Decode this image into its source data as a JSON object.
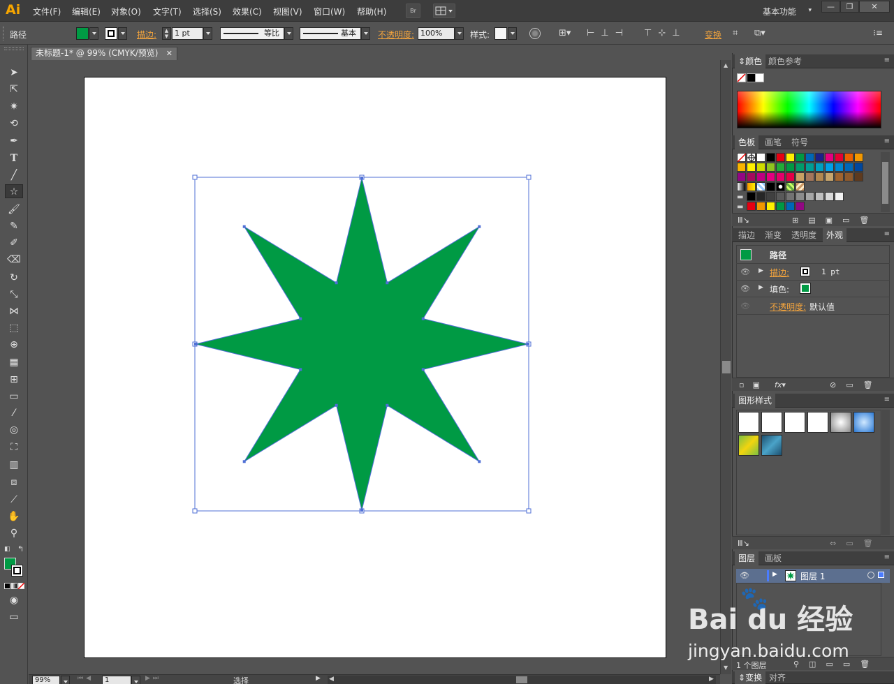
{
  "app": {
    "logo": "Ai",
    "menus": [
      "文件(F)",
      "编辑(E)",
      "对象(O)",
      "文字(T)",
      "选择(S)",
      "效果(C)",
      "视图(V)",
      "窗口(W)",
      "帮助(H)"
    ],
    "bridge_label": "Br",
    "workspace": "基本功能",
    "window_buttons": [
      "—",
      "❐",
      "✕"
    ]
  },
  "control": {
    "selection_type": "路径",
    "fill_color": "#009a44",
    "stroke_label": "描边:",
    "stroke_weight": "1 pt",
    "profile": "等比",
    "brush": "基本",
    "opacity_label": "不透明度:",
    "opacity": "100%",
    "style_label": "样式:",
    "transform_label": "变换"
  },
  "document": {
    "tab_title": "未标题-1* @ 99% (CMYK/预览)",
    "close": "✕",
    "star_color": "#009a44",
    "selection_color": "#4f6fd6"
  },
  "statusbar": {
    "zoom": "99%",
    "page": "1",
    "status": "选择"
  },
  "panels": {
    "color": {
      "tabs": [
        "颜色",
        "颜色参考"
      ]
    },
    "swatches": {
      "tabs": [
        "色板",
        "画笔",
        "符号"
      ]
    },
    "appearance": {
      "tabs": [
        "描边",
        "渐变",
        "透明度",
        "外观"
      ],
      "title": "路径",
      "stroke_label": "描边:",
      "stroke_value": "1 pt",
      "fill_label": "填色:",
      "opacity_label": "不透明度:",
      "opacity_value": "默认值"
    },
    "graphic_styles": {
      "tabs": [
        "图形样式"
      ]
    },
    "layers": {
      "tabs": [
        "图层",
        "画板"
      ],
      "layer_name": "图层 1",
      "count": "1 个图层"
    },
    "bottom_tabs": [
      "变换",
      "对齐"
    ]
  },
  "watermark": {
    "brand": "Bai du 经验",
    "url": "jingyan.baidu.com"
  },
  "swatch_colors": [
    [
      "none",
      "reg",
      "#ffffff",
      "#000000",
      "#e60012",
      "#fff100",
      "#009944",
      "#0068b7",
      "#1d2088",
      "#e4007f",
      "#e60033",
      "#eb6100",
      "#f39800"
    ],
    [
      "#f8b500",
      "#fff100",
      "#cfdb00",
      "#8fc31f",
      "#22ac38",
      "#009944",
      "#009b6b",
      "#009e96",
      "#00a0c1",
      "#00a0e9",
      "#0086d1",
      "#0068b7",
      "#00479d"
    ],
    [
      "#920783",
      "#a40b5d",
      "#be0081",
      "#e4007f",
      "#e5006a",
      "#e50046",
      "#c9a063",
      "#a4765b",
      "#b28850",
      "#c7a56c",
      "#a0642f",
      "#8f5a2c",
      "#5e3a1e"
    ]
  ],
  "gray_swatches": [
    "#000000",
    "#262626",
    "#404040",
    "#595959",
    "#737373",
    "#8c8c8c",
    "#a6a6a6",
    "#bfbfbf",
    "#d9d9d9",
    "#f2f2f2"
  ],
  "group_swatches": [
    "#e60012",
    "#f39800",
    "#fff100",
    "#009944",
    "#0068b7",
    "#920783"
  ]
}
